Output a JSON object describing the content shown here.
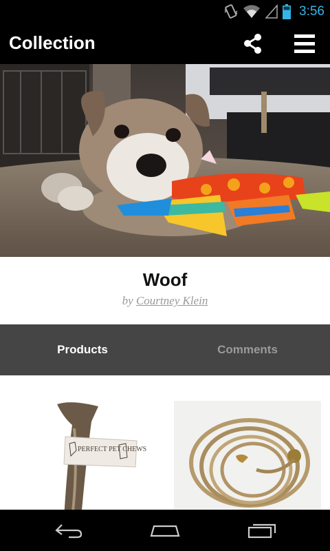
{
  "status_bar": {
    "time": "3:56",
    "icons": [
      "vibrate-icon",
      "wifi-icon",
      "signal-icon",
      "battery-icon"
    ]
  },
  "action_bar": {
    "title": "Collection",
    "actions": [
      "share-icon",
      "menu-icon"
    ]
  },
  "collection": {
    "name": "Woof",
    "by_prefix": "by",
    "author": "Courtney Klein"
  },
  "tabs": [
    {
      "label": "Products",
      "selected": true
    },
    {
      "label": "Comments",
      "selected": false
    }
  ],
  "products": [
    {
      "image": "antler-chew-product-image",
      "label_text": "PERFECT PET CHEWS"
    },
    {
      "image": "rope-leash-product-image"
    }
  ],
  "nav_bar": {
    "buttons": [
      "back-icon",
      "home-icon",
      "recent-apps-icon"
    ]
  },
  "colors": {
    "accent_time": "#33b5e5",
    "tab_bar": "#454545",
    "tab_active": "#ffffff",
    "tab_inactive": "#9a9a9a"
  }
}
